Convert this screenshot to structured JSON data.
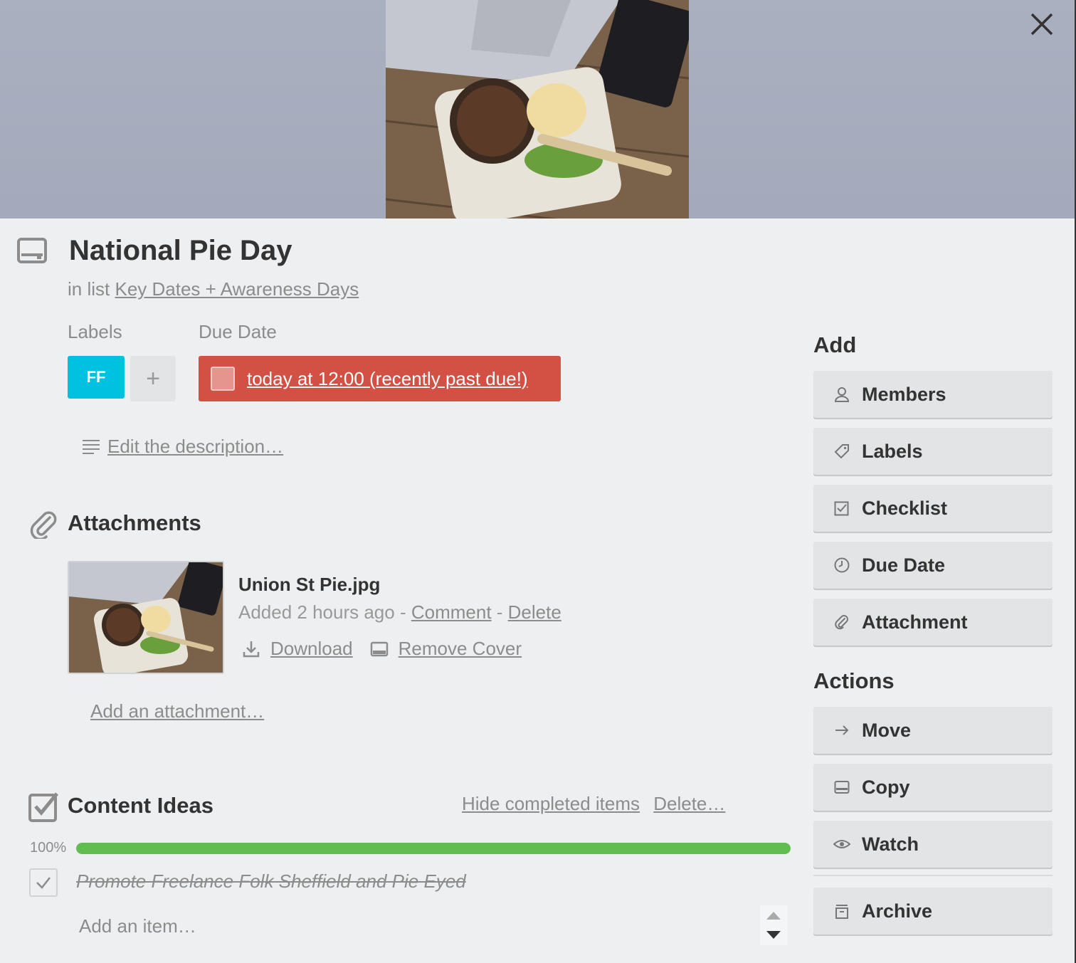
{
  "card": {
    "title": "National Pie Day",
    "in_list_prefix": "in list",
    "list_name": "Key Dates + Awareness Days"
  },
  "labels": {
    "heading": "Labels",
    "items": [
      {
        "text": "FF",
        "color": "#00c2e0"
      }
    ],
    "add_symbol": "+"
  },
  "due": {
    "heading": "Due Date",
    "text": "today at 12:00 (recently past due!)",
    "color": "#d25144"
  },
  "description": {
    "link": "Edit the description…"
  },
  "attachments": {
    "heading": "Attachments",
    "items": [
      {
        "name": "Union St Pie.jpg",
        "added": "Added 2 hours ago - ",
        "comment": "Comment",
        "sep": " - ",
        "delete": "Delete",
        "download": "Download",
        "remove_cover": "Remove Cover"
      }
    ],
    "add_link": "Add an attachment…"
  },
  "checklist": {
    "heading": "Content Ideas",
    "hide_link": "Hide completed items",
    "delete_link": "Delete…",
    "progress_label": "100%",
    "progress": 1.0,
    "items": [
      {
        "text": "Promote Freelance Folk Sheffield and Pie Eyed",
        "done": true
      }
    ],
    "add_placeholder": "Add an item…",
    "progress_color": "#61bd4f"
  },
  "sidebar": {
    "add_heading": "Add",
    "add_buttons": [
      {
        "label": "Members",
        "icon": "person-icon"
      },
      {
        "label": "Labels",
        "icon": "tag-icon"
      },
      {
        "label": "Checklist",
        "icon": "checkbox-icon"
      },
      {
        "label": "Due Date",
        "icon": "clock-icon"
      },
      {
        "label": "Attachment",
        "icon": "paperclip-icon"
      }
    ],
    "actions_heading": "Actions",
    "action_buttons": [
      {
        "label": "Move",
        "icon": "arrow-right-icon"
      },
      {
        "label": "Copy",
        "icon": "card-icon"
      },
      {
        "label": "Watch",
        "icon": "eye-icon"
      },
      {
        "label": "Archive",
        "icon": "archive-icon"
      }
    ]
  }
}
